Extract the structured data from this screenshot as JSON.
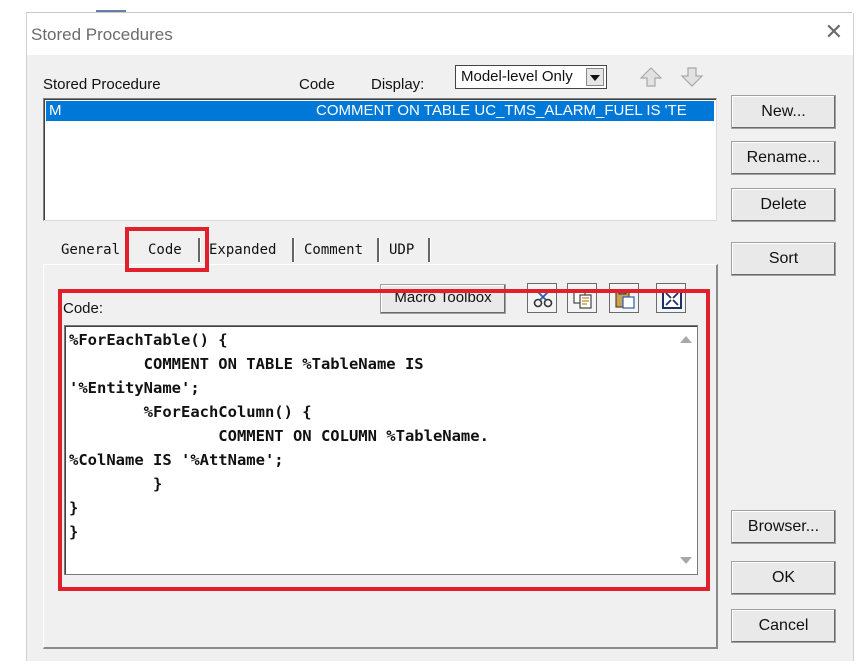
{
  "window": {
    "title": "Stored Procedures",
    "close_glyph": "✕"
  },
  "header": {
    "stored_procedure_label": "Stored Procedure",
    "code_label": "Code",
    "display_label": "Display:",
    "display_value": "Model-level Only"
  },
  "list": {
    "rows": [
      {
        "name": "M",
        "code": "COMMENT ON TABLE UC_TMS_ALARM_FUEL IS 'TE"
      }
    ]
  },
  "buttons": {
    "new": "New...",
    "rename": "Rename...",
    "delete": "Delete",
    "sort": "Sort",
    "browser": "Browser...",
    "ok": "OK",
    "cancel": "Cancel"
  },
  "tabs": [
    {
      "label": "General"
    },
    {
      "label": "Code",
      "selected": true
    },
    {
      "label": "Expanded"
    },
    {
      "label": "Comment"
    },
    {
      "label": "UDP"
    }
  ],
  "code_panel": {
    "label": "Code:",
    "macro_toolbox": "Macro Toolbox",
    "tools": [
      "cut-icon",
      "copy-icon",
      "paste-icon",
      "fit-icon"
    ],
    "lines": [
      "%ForEachTable() {",
      "        COMMENT ON TABLE %TableName IS",
      "'%EntityName';",
      "        %ForEachColumn() {",
      "                COMMENT ON COLUMN %TableName.",
      "%ColName IS '%AttName';",
      "         }",
      "}",
      "}"
    ]
  },
  "colors": {
    "selection": "#0078d7",
    "highlight": "#e0202a",
    "dialog_bg": "#f0f0f0"
  }
}
